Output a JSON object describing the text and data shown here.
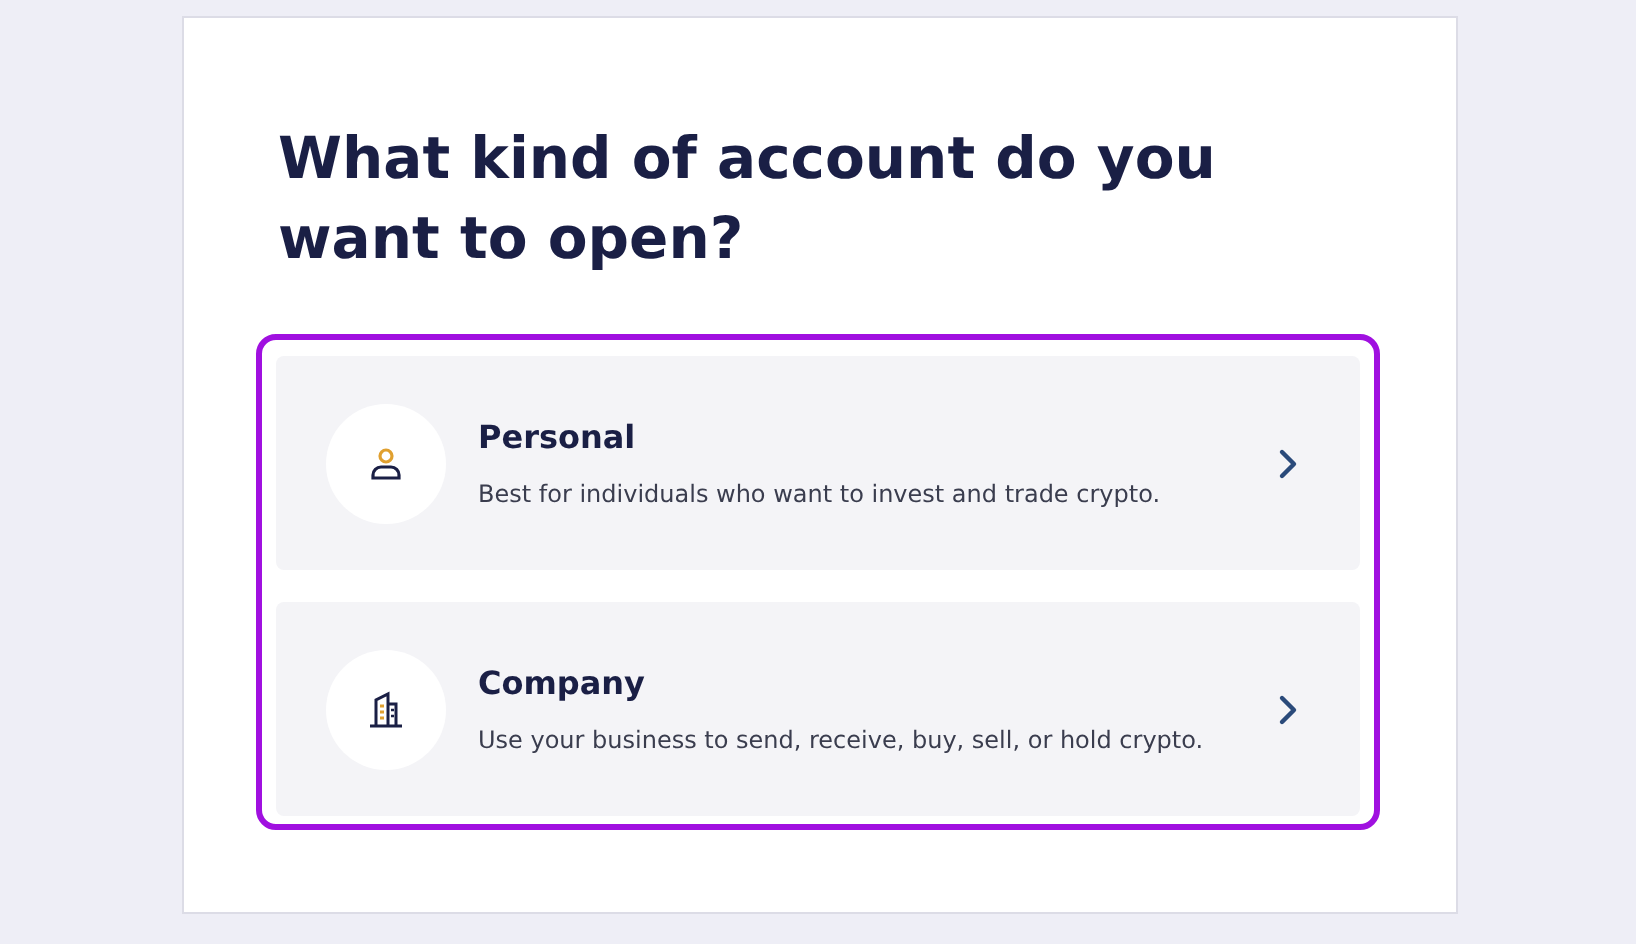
{
  "heading": "What kind of account do you want to open?",
  "options": [
    {
      "kind": "person",
      "title": "Personal",
      "description": "Best for individuals who want to invest and trade crypto."
    },
    {
      "kind": "building",
      "title": "Company",
      "description": "Use your business to send, receive, buy, sell, or hold crypto."
    }
  ]
}
